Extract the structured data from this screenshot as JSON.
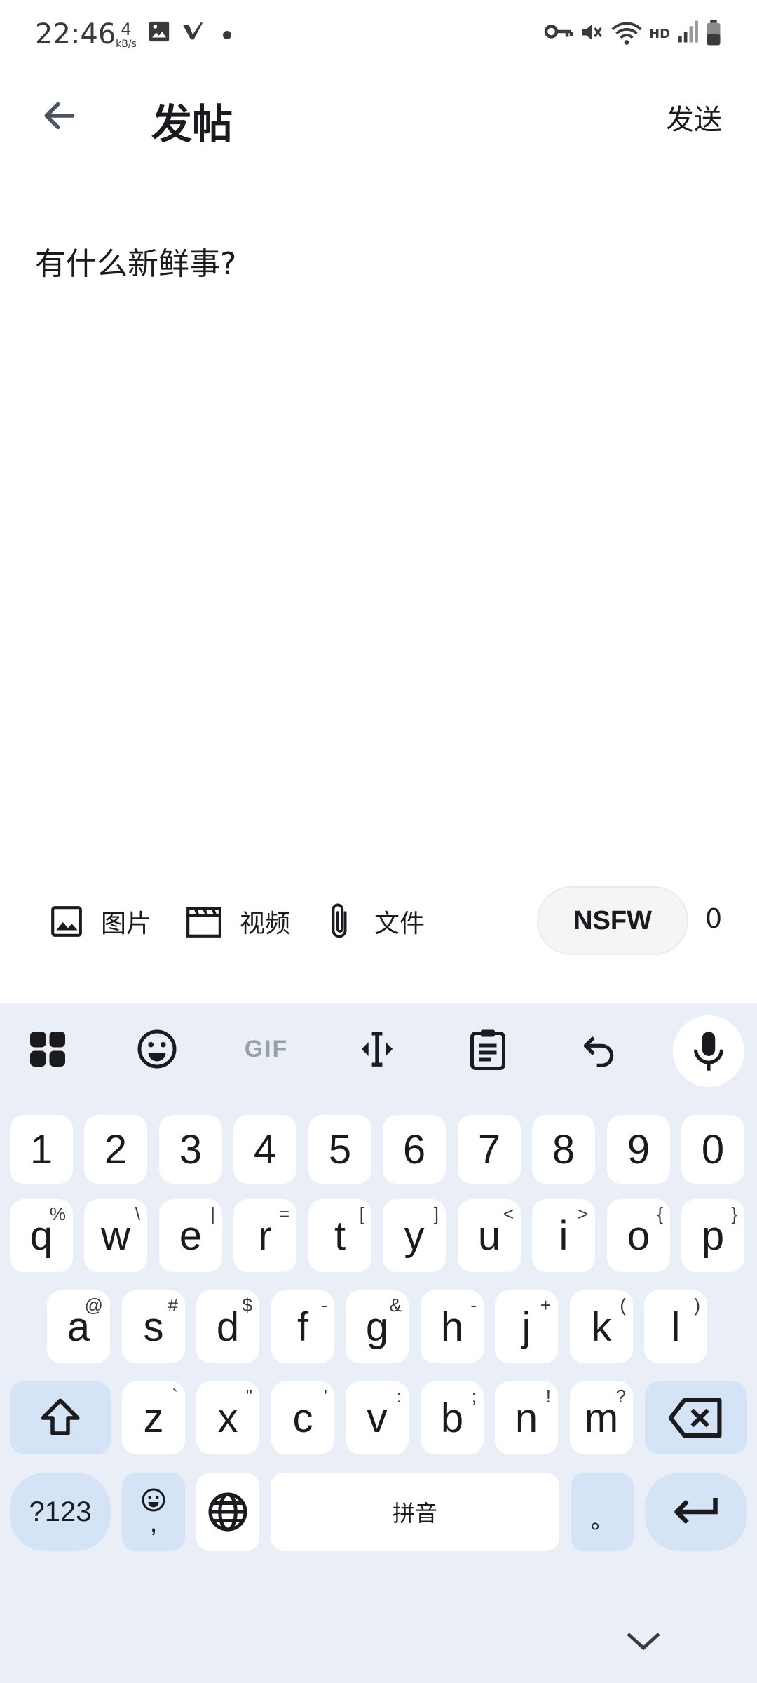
{
  "status_bar": {
    "time": "22:46",
    "speed_value": "4",
    "speed_unit": "kB/s",
    "hd": "HD"
  },
  "app_bar": {
    "title": "发帖",
    "send_label": "发送"
  },
  "compose": {
    "placeholder": "有什么新鲜事?"
  },
  "attach_bar": {
    "image_label": "图片",
    "video_label": "视频",
    "file_label": "文件",
    "nsfw_label": "NSFW",
    "char_count": "0"
  },
  "keyboard": {
    "gif_label": "GIF",
    "number_row": [
      "1",
      "2",
      "3",
      "4",
      "5",
      "6",
      "7",
      "8",
      "9",
      "0"
    ],
    "row1": [
      {
        "key": "q",
        "hint": "%"
      },
      {
        "key": "w",
        "hint": "\\"
      },
      {
        "key": "e",
        "hint": "|"
      },
      {
        "key": "r",
        "hint": "="
      },
      {
        "key": "t",
        "hint": "["
      },
      {
        "key": "y",
        "hint": "]"
      },
      {
        "key": "u",
        "hint": "<"
      },
      {
        "key": "i",
        "hint": ">"
      },
      {
        "key": "o",
        "hint": "{"
      },
      {
        "key": "p",
        "hint": "}"
      }
    ],
    "row2": [
      {
        "key": "a",
        "hint": "@"
      },
      {
        "key": "s",
        "hint": "#"
      },
      {
        "key": "d",
        "hint": "$"
      },
      {
        "key": "f",
        "hint": "-"
      },
      {
        "key": "g",
        "hint": "&"
      },
      {
        "key": "h",
        "hint": "-"
      },
      {
        "key": "j",
        "hint": "+"
      },
      {
        "key": "k",
        "hint": "("
      },
      {
        "key": "l",
        "hint": ")"
      }
    ],
    "row3": [
      {
        "key": "z",
        "hint": "`"
      },
      {
        "key": "x",
        "hint": "\""
      },
      {
        "key": "c",
        "hint": "'"
      },
      {
        "key": "v",
        "hint": ":"
      },
      {
        "key": "b",
        "hint": ";"
      },
      {
        "key": "n",
        "hint": "!"
      },
      {
        "key": "m",
        "hint": "?"
      }
    ],
    "symbols_label": "?123",
    "comma_label": ",",
    "space_label": "拼音",
    "period_label": "。"
  }
}
